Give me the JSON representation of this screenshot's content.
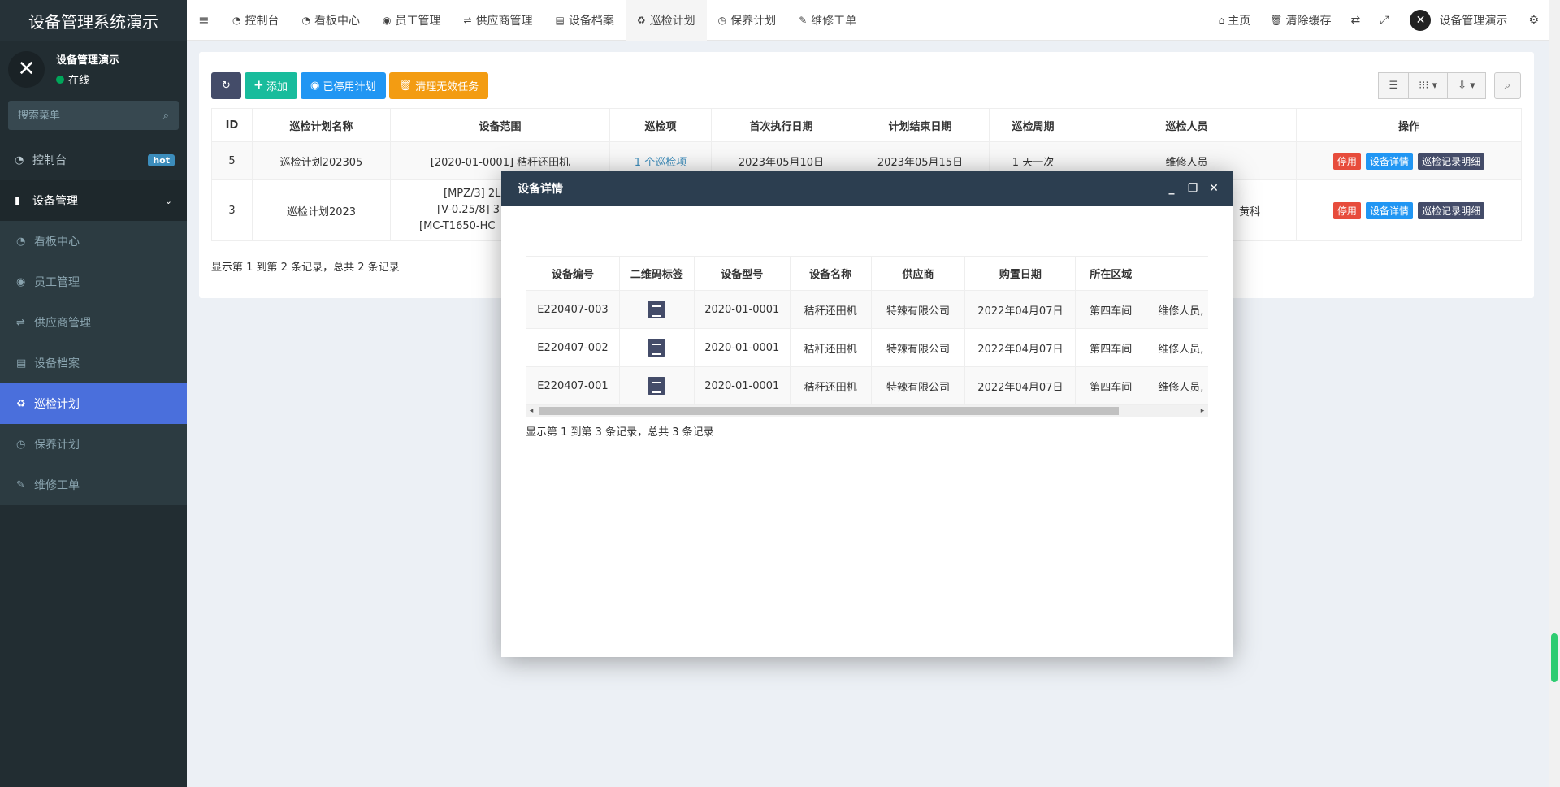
{
  "sidebar": {
    "brand": "设备管理系统演示",
    "user_name": "设备管理演示",
    "user_status": "在线",
    "search_placeholder": "搜索菜单",
    "items": {
      "dashboard": "控制台",
      "hot_badge": "hot",
      "equipment": "设备管理",
      "board": "看板中心",
      "staff": "员工管理",
      "supplier": "供应商管理",
      "archive": "设备档案",
      "inspection": "巡检计划",
      "maintenance": "保养计划",
      "repair": "维修工单"
    }
  },
  "header": {
    "tabs": [
      "控制台",
      "看板中心",
      "员工管理",
      "供应商管理",
      "设备档案",
      "巡检计划",
      "保养计划",
      "维修工单"
    ],
    "home": "主页",
    "clear_cache": "清除缓存",
    "user": "设备管理演示"
  },
  "toolbar": {
    "add": "添加",
    "disabled_plans": "已停用计划",
    "clear_tasks": "清理无效任务"
  },
  "main_table": {
    "columns": [
      "ID",
      "巡检计划名称",
      "设备范围",
      "巡检项",
      "首次执行日期",
      "计划结束日期",
      "巡检周期",
      "巡检人员",
      "操作"
    ],
    "rows": [
      {
        "id": "5",
        "name": "巡检计划202305",
        "scope": "[2020-01-0001] 秸秆还田机",
        "items": "1 个巡检项",
        "first_date": "2023年05月10日",
        "end_date": "2023年05月15日",
        "cycle": "1 天一次",
        "staff": "维修人员"
      },
      {
        "id": "3",
        "name": "巡检计划2023",
        "scope_lines": [
          "[MPZ/3] 2L",
          "[V-0.25/8] 3",
          "[MC-T1650-HC"
        ],
        "staff_fragment": "黄科"
      }
    ],
    "action_labels": {
      "disable": "停用",
      "detail": "设备详情",
      "records": "巡检记录明细"
    },
    "page_info": "显示第 1 到第 2 条记录，总共 2 条记录"
  },
  "modal": {
    "title": "设备详情",
    "columns": [
      "设备编号",
      "二维码标签",
      "设备型号",
      "设备名称",
      "供应商",
      "购置日期",
      "所在区域",
      "负"
    ],
    "rows": [
      {
        "code": "E220407-003",
        "model": "2020-01-0001",
        "name": "秸秆还田机",
        "supplier": "特辣有限公司",
        "date": "2022年04月07日",
        "area": "第四车间",
        "staff": "维修人员,"
      },
      {
        "code": "E220407-002",
        "model": "2020-01-0001",
        "name": "秸秆还田机",
        "supplier": "特辣有限公司",
        "date": "2022年04月07日",
        "area": "第四车间",
        "staff": "维修人员,"
      },
      {
        "code": "E220407-001",
        "model": "2020-01-0001",
        "name": "秸秆还田机",
        "supplier": "特辣有限公司",
        "date": "2022年04月07日",
        "area": "第四车间",
        "staff": "维修人员,"
      }
    ],
    "page_info": "显示第 1 到第 3 条记录，总共 3 条记录"
  },
  "colors": {
    "sidebar_bg": "#222d32",
    "active_menu": "#4a6fdc",
    "modal_header": "#2c3e50",
    "btn_green": "#18bc9c",
    "btn_blue": "#2196f3",
    "btn_orange": "#f39c12",
    "btn_red": "#e74c3c"
  }
}
